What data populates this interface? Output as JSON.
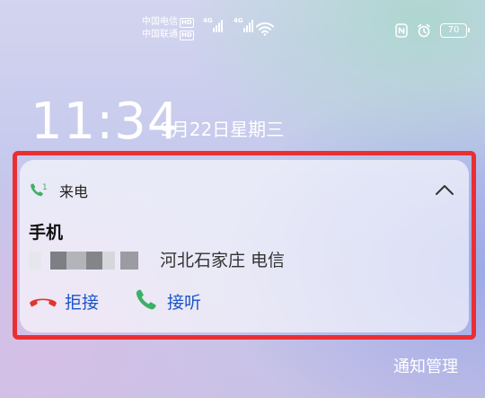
{
  "status_bar": {
    "carrier_1": "中国电信",
    "carrier_2": "中国联通",
    "hd_label": "HD",
    "network_1": "4G",
    "network_2": "4G",
    "battery_level": "70",
    "icons": [
      "nfc-icon",
      "alarm-icon",
      "wifi-icon"
    ]
  },
  "lockscreen": {
    "time": "11:34",
    "date": "9月22日星期三"
  },
  "notification": {
    "app_name": "来电",
    "caller_name": "手机",
    "caller_location": "河北石家庄 电信",
    "decline_label": "拒接",
    "answer_label": "接听",
    "sim_slot": "1",
    "accent_color": "#1a56c8",
    "decline_color": "#e0362e",
    "answer_color": "#3db067",
    "highlight_color": "#ea2f33"
  },
  "footer": {
    "manage_label": "通知管理"
  }
}
